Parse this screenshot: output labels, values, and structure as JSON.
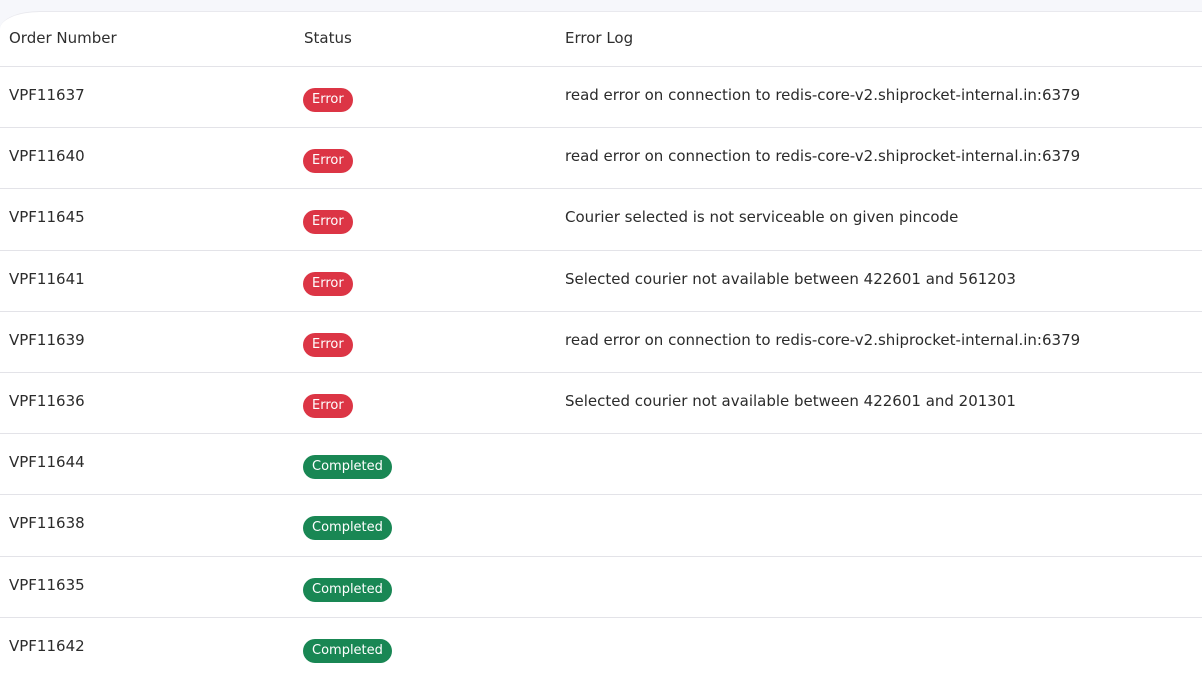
{
  "table": {
    "headers": {
      "order_number": "Order Number",
      "status": "Status",
      "error_log": "Error Log"
    },
    "rows": [
      {
        "order_number": "VPF11637",
        "status": "Error",
        "status_type": "error",
        "error_log": "read error on connection to redis-core-v2.shiprocket-internal.in:6379"
      },
      {
        "order_number": "VPF11640",
        "status": "Error",
        "status_type": "error",
        "error_log": "read error on connection to redis-core-v2.shiprocket-internal.in:6379"
      },
      {
        "order_number": "VPF11645",
        "status": "Error",
        "status_type": "error",
        "error_log": "Courier selected is not serviceable on given pincode"
      },
      {
        "order_number": "VPF11641",
        "status": "Error",
        "status_type": "error",
        "error_log": "Selected courier not available between 422601 and 561203"
      },
      {
        "order_number": "VPF11639",
        "status": "Error",
        "status_type": "error",
        "error_log": "read error on connection to redis-core-v2.shiprocket-internal.in:6379"
      },
      {
        "order_number": "VPF11636",
        "status": "Error",
        "status_type": "error",
        "error_log": "Selected courier not available between 422601 and 201301"
      },
      {
        "order_number": "VPF11644",
        "status": "Completed",
        "status_type": "completed",
        "error_log": ""
      },
      {
        "order_number": "VPF11638",
        "status": "Completed",
        "status_type": "completed",
        "error_log": ""
      },
      {
        "order_number": "VPF11635",
        "status": "Completed",
        "status_type": "completed",
        "error_log": ""
      },
      {
        "order_number": "VPF11642",
        "status": "Completed",
        "status_type": "completed",
        "error_log": ""
      }
    ]
  },
  "colors": {
    "error": "#dc3545",
    "completed": "#198754"
  }
}
